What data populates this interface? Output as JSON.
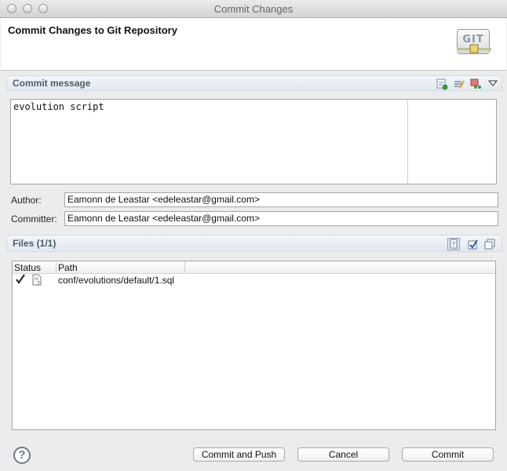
{
  "window": {
    "title": "Commit Changes"
  },
  "header": {
    "title": "Commit Changes to Git Repository",
    "logo_text": "GIT"
  },
  "commit_section": {
    "title": "Commit message",
    "message": "evolution script",
    "tools": [
      "spell-check-icon",
      "add-signed-off-icon",
      "amend-icon",
      "menu-dropdown-icon"
    ]
  },
  "author": {
    "label": "Author:",
    "value": "Eamonn de Leastar <edeleastar@gmail.com>"
  },
  "committer": {
    "label": "Committer:",
    "value": "Eamonn de Leastar <edeleastar@gmail.com>"
  },
  "files_section": {
    "title": "Files (1/1)",
    "columns": [
      "Status",
      "Path"
    ],
    "rows": [
      {
        "checked": true,
        "status_icon": "untracked-file-icon",
        "path": "conf/evolutions/default/1.sql"
      }
    ]
  },
  "buttons": {
    "help": "?",
    "commit_and_push": "Commit and Push",
    "cancel": "Cancel",
    "commit": "Commit"
  }
}
